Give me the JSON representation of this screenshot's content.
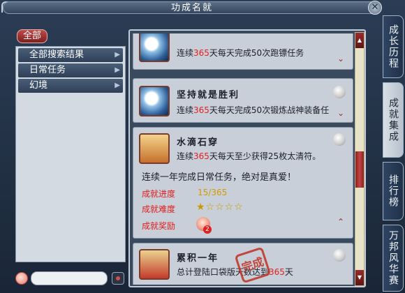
{
  "window": {
    "title": "功成名就",
    "close_label": "✕"
  },
  "side_tabs": [
    {
      "label": "成长历程",
      "active": false
    },
    {
      "label": "成就集成",
      "active": true
    },
    {
      "label": "排行榜",
      "active": false
    },
    {
      "label": "万邦风华赛",
      "active": false
    }
  ],
  "left": {
    "all_label": "全部",
    "categories": [
      {
        "label": "全部搜索结果"
      },
      {
        "label": "日常任务"
      },
      {
        "label": "幻境"
      }
    ],
    "search": {
      "placeholder": "",
      "value": ""
    }
  },
  "cards": [
    {
      "name": "",
      "desc_prefix": "连续",
      "desc_highlight": "365",
      "desc_suffix": "天每天完成50次跑镖任务",
      "icon": "moon-orb-icon"
    },
    {
      "name": "坚持就是胜利",
      "desc_prefix": "连续",
      "desc_highlight": "365",
      "desc_suffix": "天每天完成50次锻炼战神装备任",
      "icon": "moon-orb-icon"
    },
    {
      "name": "水滴石穿",
      "desc_prefix": "连续",
      "desc_highlight": "365",
      "desc_suffix": "天每天至少获得25枚太清符。",
      "icon": "book-icon",
      "detail": "连续一年完成日常任务，绝对是真爱！",
      "progress_label": "成就进度",
      "progress_value": "15/365",
      "progress": 0.041,
      "difficulty_label": "成就难度",
      "difficulty_stars": "★☆☆☆☆",
      "difficulty": 1,
      "reward_label": "成就奖励",
      "reward_count": "2"
    },
    {
      "name": "累积一年",
      "desc_prefix": "总计登陆口袋版天数达到",
      "desc_highlight": "365",
      "desc_suffix": "天",
      "icon": "red-pouch-icon",
      "stamp": "完成"
    }
  ],
  "colors": {
    "highlight": "#e02020",
    "progress": "#d09a00",
    "accent": "#c24343"
  }
}
